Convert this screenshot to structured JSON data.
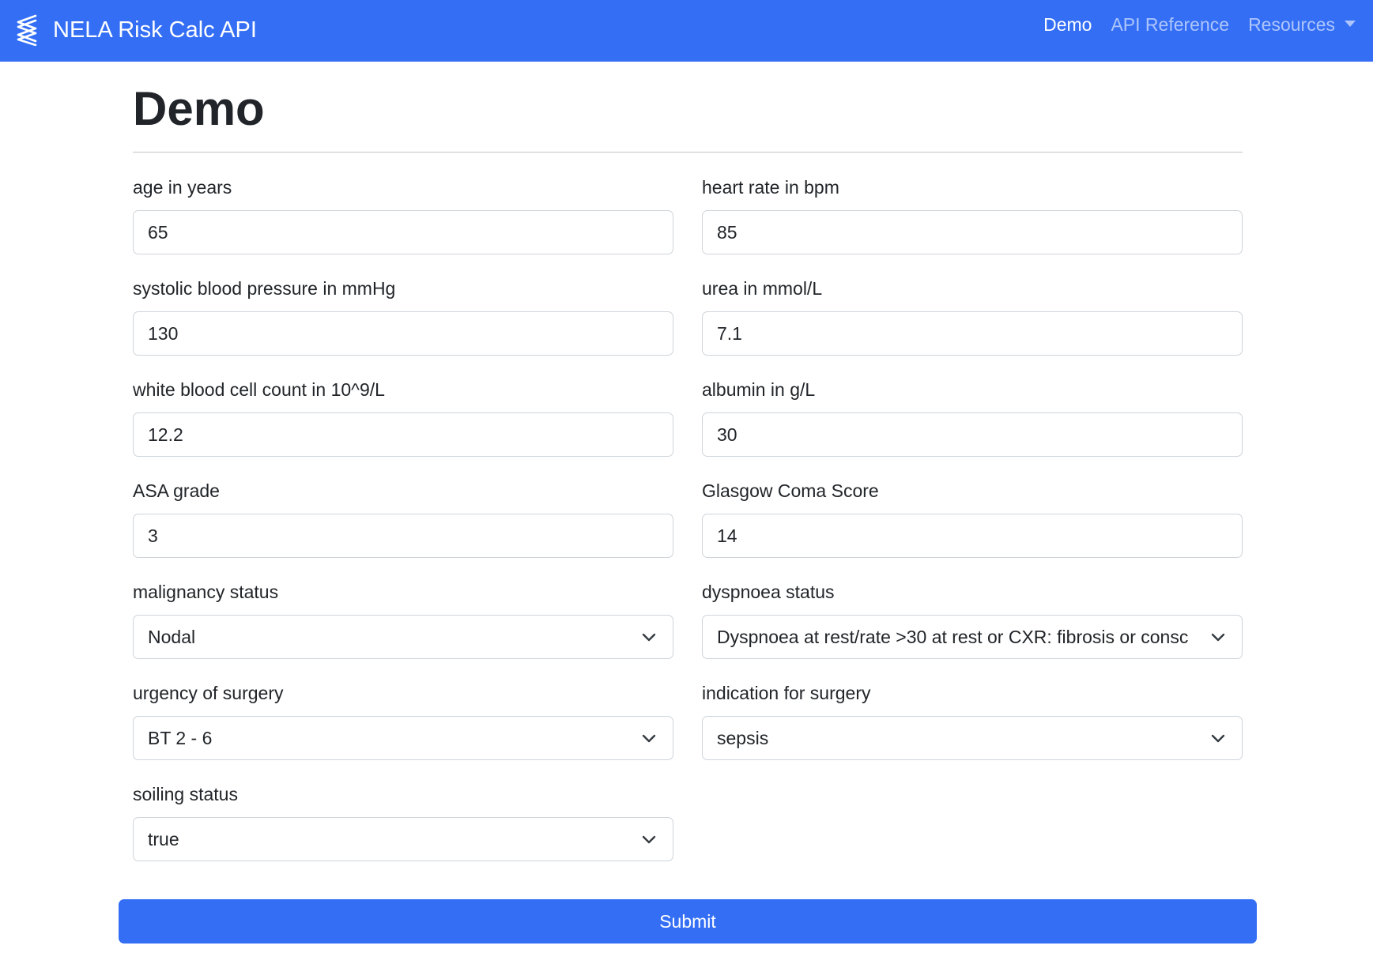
{
  "navbar": {
    "brand": "NELA Risk Calc API",
    "brand_icon": "logo-zigzag-icon",
    "links": [
      {
        "label": "Demo",
        "active": true
      },
      {
        "label": "API Reference",
        "active": false
      },
      {
        "label": "Resources",
        "active": false,
        "dropdown": true
      }
    ]
  },
  "page": {
    "title": "Demo"
  },
  "form": {
    "age": {
      "label": "age in years",
      "value": "65"
    },
    "heart_rate": {
      "label": "heart rate in bpm",
      "value": "85"
    },
    "systolic": {
      "label": "systolic blood pressure in mmHg",
      "value": "130"
    },
    "urea": {
      "label": "urea in mmol/L",
      "value": "7.1"
    },
    "wbc": {
      "label": "white blood cell count in 10^9/L",
      "value": "12.2"
    },
    "albumin": {
      "label": "albumin in g/L",
      "value": "30"
    },
    "asa": {
      "label": "ASA grade",
      "value": "3"
    },
    "gcs": {
      "label": "Glasgow Coma Score",
      "value": "14"
    },
    "malignancy": {
      "label": "malignancy status",
      "value": "Nodal"
    },
    "dyspnoea": {
      "label": "dyspnoea status",
      "value": "Dyspnoea at rest/rate >30 at rest or CXR: fibrosis or consc"
    },
    "urgency": {
      "label": "urgency of surgery",
      "value": "BT 2 - 6"
    },
    "indication": {
      "label": "indication for surgery",
      "value": "sepsis"
    },
    "soiling": {
      "label": "soiling status",
      "value": "true"
    },
    "submit_label": "Submit"
  },
  "colors": {
    "primary": "#336ef5",
    "border": "#ced4da",
    "text": "#212529"
  }
}
